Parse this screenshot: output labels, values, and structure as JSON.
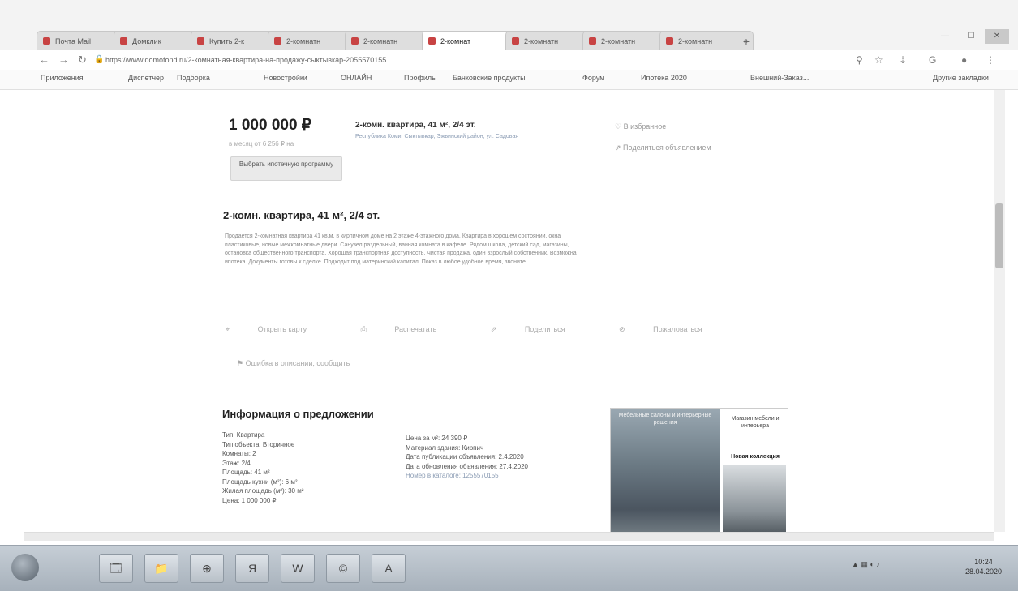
{
  "browser": {
    "tabs": [
      {
        "label": "Почта Mail",
        "active": false
      },
      {
        "label": "Домклик",
        "active": false
      },
      {
        "label": "Купить 2-к",
        "active": false
      },
      {
        "label": "2-комнатн",
        "active": false
      },
      {
        "label": "2-комнатн",
        "active": false
      },
      {
        "label": "2-комнат",
        "active": true
      },
      {
        "label": "2-комнатн",
        "active": false
      },
      {
        "label": "2-комнатн",
        "active": false
      },
      {
        "label": "2-комнатн",
        "active": false
      }
    ],
    "new_tab": "+",
    "address": "https://www.domofond.ru/2-комнатная-квартира-на-продажу-сыктывкар-2055570155",
    "bookmarks": [
      "Приложения",
      "Диспетчер",
      "Подборка",
      "Новостройки",
      "ОНЛАЙН",
      "Профиль",
      "Банковские продукты",
      "Форум",
      "Ипотека 2020",
      "Внешний-Заказ...",
      "Другие закладки"
    ]
  },
  "listing": {
    "price": "1 000 000 ₽",
    "price_per_m": "в месяц от 6 256 ₽ на",
    "mortgage_button": "Выбрать ипотечную программу",
    "card_title": "2-комн. квартира, 41 м², 2/4 эт.",
    "card_address": "Республика Коми, Сыктывкар, Эжвинский район, ул. Садовая",
    "favorite": "В избранное",
    "share": "Поделиться объявлением",
    "title": "2-комн. квартира, 41 м², 2/4 эт.",
    "description": "Продается 2-комнатная квартира 41 кв.м. в кирпичном доме на 2 этаже 4-этажного дома. Квартира в хорошем состоянии, окна пластиковые, новые межкомнатные двери. Санузел раздельный, ванная комната в кафеле. Рядом школа, детский сад, магазины, остановка общественного транспорта. Хорошая транспортная доступность. Чистая продажа, один взрослый собственник. Возможна ипотека. Документы готовы к сделке. Подходит под материнский капитал. Показ в любое удобное время, звоните.",
    "actions": [
      "Открыть карту",
      "Распечатать",
      "Поделиться",
      "Пожаловаться"
    ],
    "complaint": "Ошибка в описании, сообщить",
    "info_title": "Информация о предложении",
    "info_left": [
      "Тип: Квартира",
      "Тип объекта: Вторичное",
      "Комнаты: 2",
      "Этаж: 2/4",
      "Площадь: 41 м²",
      "Площадь кухни (м²): 6 м²",
      "Жилая площадь (м²): 30 м²",
      "Цена: 1 000 000 ₽"
    ],
    "info_right": [
      "Цена за м²: 24 390 ₽",
      "Материал здания: Кирпич",
      "Дата публикации объявления: 2.4.2020",
      "Дата обновления объявления: 27.4.2020",
      "Номер в каталоге: 1255570155"
    ],
    "ad_left_text": "Мебельные салоны и интерьерные решения",
    "ad_right_text": "Магазин мебели и интерьера",
    "ad_right_caption": "Новая коллекция"
  },
  "taskbar": {
    "items": [
      "🗔",
      "📁",
      "⊕",
      "Я",
      "W",
      "©",
      "A"
    ],
    "time": "10:24",
    "date": "28.04.2020"
  }
}
